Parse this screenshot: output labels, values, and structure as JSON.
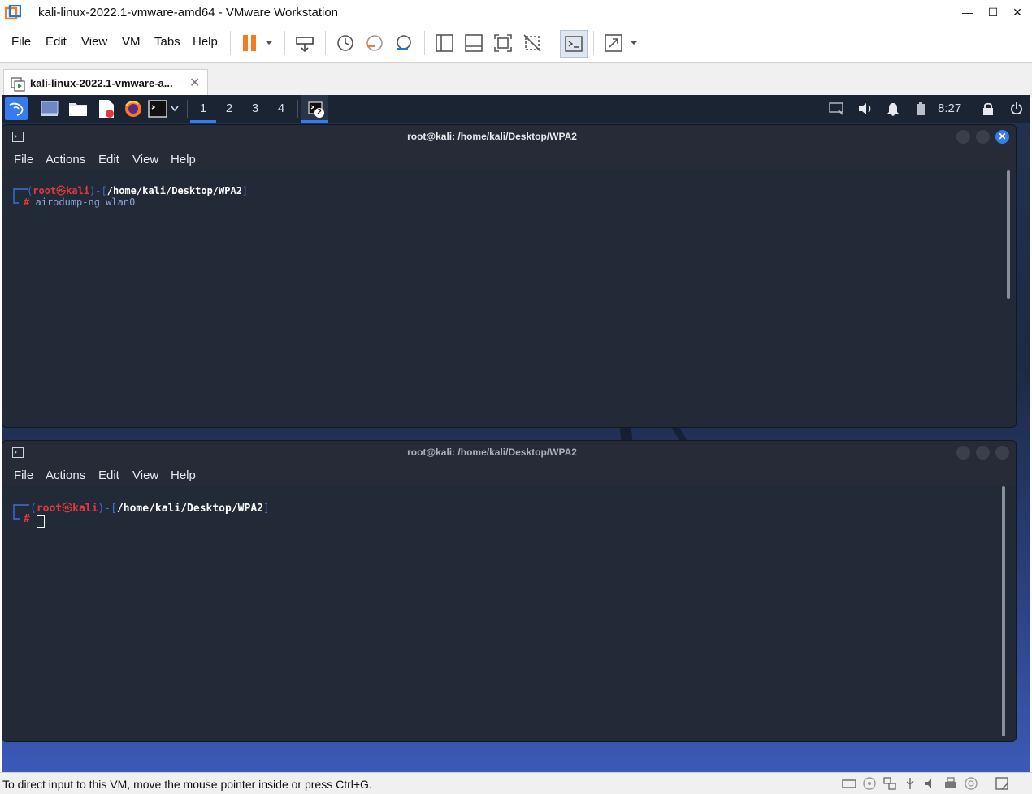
{
  "window": {
    "title": "kali-linux-2022.1-vmware-amd64 - VMware Workstation"
  },
  "menu": {
    "file": "File",
    "edit": "Edit",
    "view": "View",
    "vm": "VM",
    "tabs": "Tabs",
    "help": "Help"
  },
  "vm_tab": {
    "label": "kali-linux-2022.1-vmware-a..."
  },
  "panel": {
    "workspaces": [
      "1",
      "2",
      "3",
      "4"
    ],
    "terminal_badge": "2",
    "clock": "8:27"
  },
  "terminal_top": {
    "title": "root@kali: /home/kali/Desktop/WPA2",
    "menu": [
      "File",
      "Actions",
      "Edit",
      "View",
      "Help"
    ],
    "prompt_user": "root",
    "prompt_at": "㉿",
    "prompt_host": "kali",
    "prompt_path": "/home/kali/Desktop/WPA2",
    "prompt_hash": "#",
    "command": "airodump-ng wlan0"
  },
  "terminal_bottom": {
    "title": "root@kali: /home/kali/Desktop/WPA2",
    "menu": [
      "File",
      "Actions",
      "Edit",
      "View",
      "Help"
    ],
    "prompt_user": "root",
    "prompt_at": "㉿",
    "prompt_host": "kali",
    "prompt_path": "/home/kali/Desktop/WPA2",
    "prompt_hash": "#"
  },
  "statusbar": {
    "message": "To direct input to this VM, move the mouse pointer inside or press Ctrl+G."
  },
  "colors": {
    "accent_blue": "#367bf0",
    "prompt_red": "#e0393e",
    "prompt_blue": "#3c6ee0",
    "pause_orange": "#f47b20"
  }
}
